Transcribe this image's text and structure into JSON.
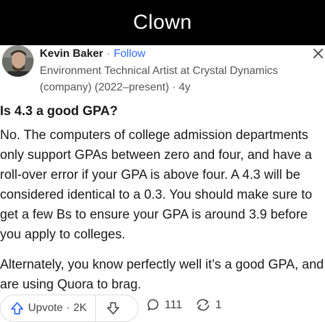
{
  "meme": {
    "caption": "Clown"
  },
  "author": {
    "name": "Kevin Baker",
    "separator": "·",
    "follow_label": "Follow",
    "credential": "Environment Technical Artist at Crystal Dynamics (company) (2022–present) · 4y"
  },
  "post": {
    "question": "Is 4.3 a good GPA?",
    "answer_paragraphs": [
      "No. The computers of college admission departments only support GPAs between zero and four, and have a roll-over error if your GPA is above four. A 4.3 will be considered identical to a 0.3. You should make sure to get a few Bs to ensure your GPA is around 3.9 before you apply to colleges.",
      "Alternately, you know perfectly well it’s a good GPA, and are using Quora to brag."
    ]
  },
  "actions": {
    "upvote_label": "Upvote",
    "upvote_separator": "·",
    "upvote_count": "2K",
    "comment_count": "111",
    "share_count": "1"
  },
  "icons": {
    "close": "close-icon",
    "upvote": "upvote-arrow-icon",
    "downvote": "downvote-arrow-icon",
    "comment": "comment-bubble-icon",
    "share": "share-arrows-icon"
  },
  "colors": {
    "follow": "#2e69ff",
    "meme_bar": "#000000",
    "upvote_icon": "#2e69ff"
  }
}
